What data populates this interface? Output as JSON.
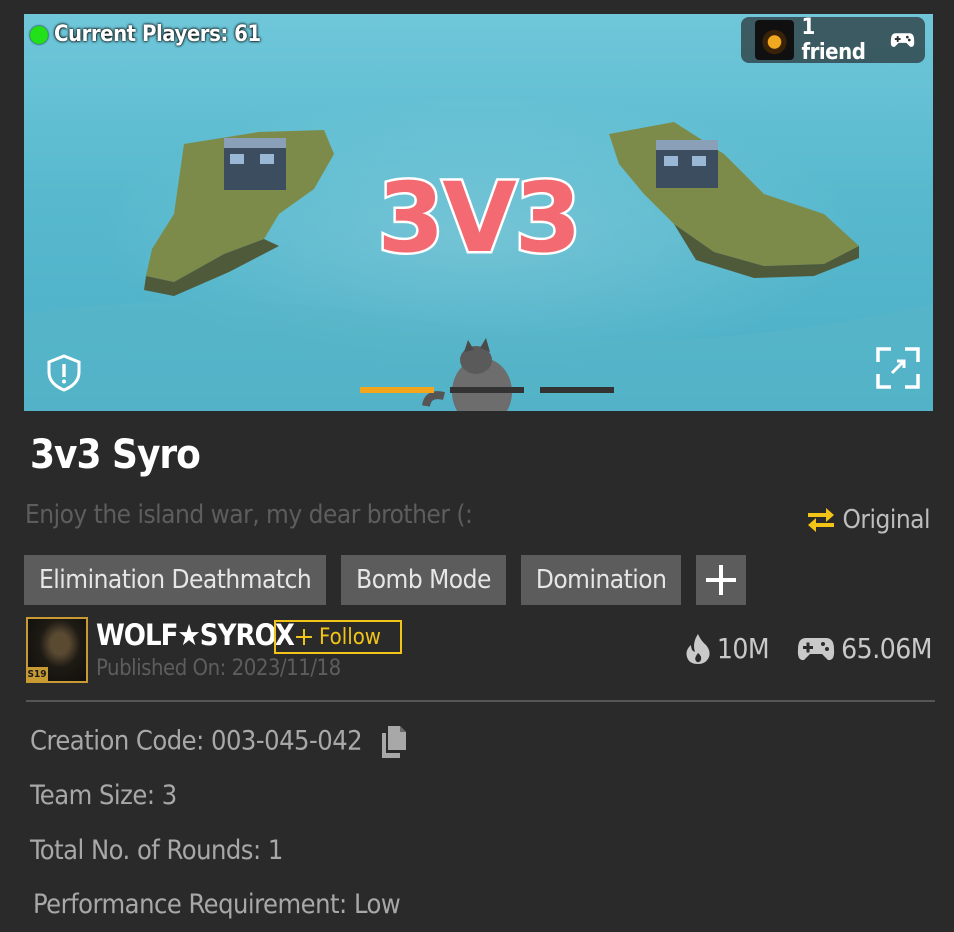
{
  "banner": {
    "players_label": "Current Players: 61",
    "friend_label": "1 friend",
    "overlay_text": "3V3",
    "carousel_active_index": 0,
    "carousel_count": 3,
    "icons": {
      "status": "online-dot-icon",
      "friend_avatar": "avatar-icon",
      "friend_gamepad": "gamepad-icon",
      "report": "shield-warning-icon",
      "fullscreen": "expand-icon"
    }
  },
  "map": {
    "title": "3v3 Syro",
    "description": "Enjoy the island war, my dear brother (:",
    "original_label": "Original",
    "tags": [
      "Elimination Deathmatch",
      "Bomb Mode",
      "Domination"
    ]
  },
  "author": {
    "name": "WOLF★SYROX",
    "avatar_badge": "S19",
    "follow_label": "Follow",
    "published": "Published On: 2023/11/18"
  },
  "stats": {
    "popularity": "10M",
    "plays": "65.06M"
  },
  "info": {
    "creation_code_label": "Creation Code: 003-045-042",
    "team_size_label": "Team Size: 3",
    "rounds_label": "Total No. of Rounds: 1",
    "performance_label": "Performance Requirement: Low"
  },
  "colors": {
    "accent_yellow": "#f2c418",
    "carousel_active": "#f3a51b",
    "online_green": "#22e01a",
    "background": "#2a2a2a"
  }
}
